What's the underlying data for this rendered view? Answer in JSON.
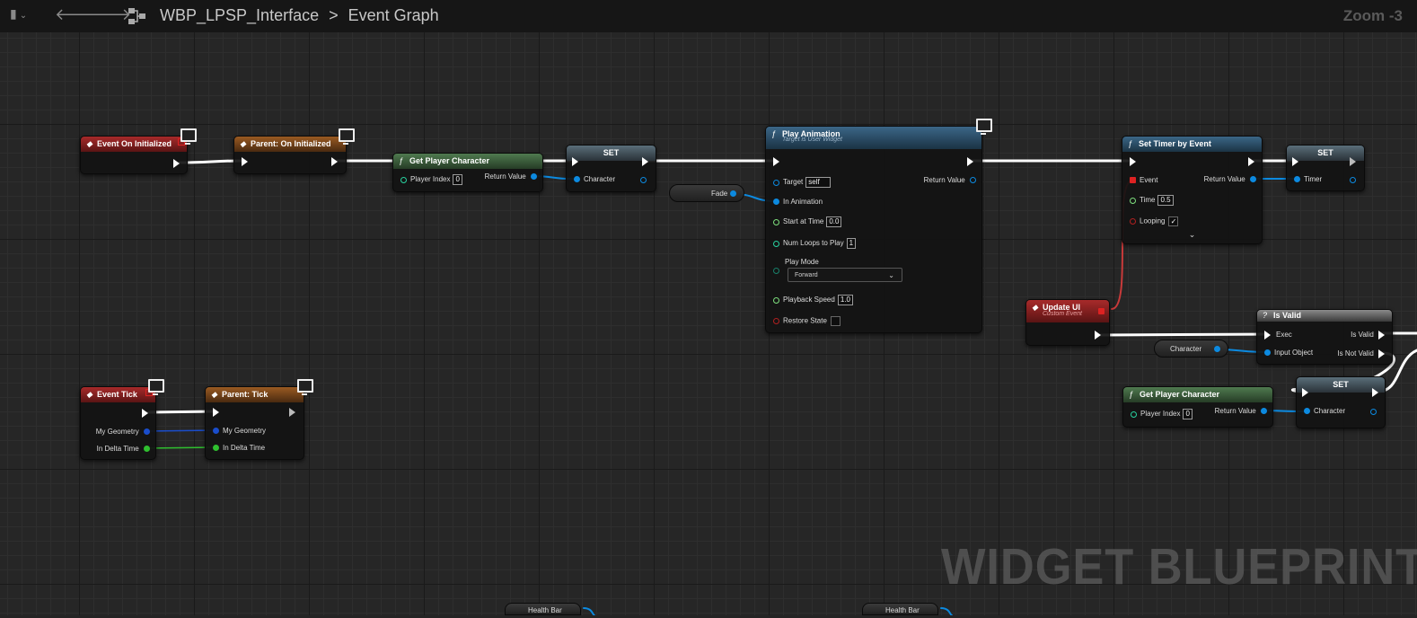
{
  "toolbar": {
    "breadcrumb_asset": "WBP_LPSP_Interface",
    "breadcrumb_separator": ">",
    "breadcrumb_graph": "Event Graph",
    "zoom": "Zoom -3"
  },
  "watermark": "WIDGET BLUEPRINT",
  "nodes": {
    "event_on_initialized": {
      "title": "Event On Initialized"
    },
    "parent_on_initialized": {
      "title": "Parent: On Initialized"
    },
    "get_player_character_1": {
      "title": "Get Player Character",
      "player_index_label": "Player Index",
      "player_index_value": "0",
      "return_label": "Return Value"
    },
    "set_1": {
      "title": "SET",
      "character_label": "Character"
    },
    "play_animation": {
      "title": "Play Animation",
      "subtitle": "Target is User Widget",
      "target_label": "Target",
      "target_value": "self",
      "in_animation_label": "In Animation",
      "start_at_time_label": "Start at Time",
      "start_at_time_value": "0.0",
      "num_loops_label": "Num Loops to Play",
      "num_loops_value": "1",
      "play_mode_label": "Play Mode",
      "play_mode_value": "Forward",
      "playback_speed_label": "Playback Speed",
      "playback_speed_value": "1.0",
      "restore_state_label": "Restore State",
      "return_label": "Return Value"
    },
    "fade_var": {
      "label": "Fade"
    },
    "set_timer_by_event": {
      "title": "Set Timer by Event",
      "event_label": "Event",
      "return_label": "Return Value",
      "time_label": "Time",
      "time_value": "0.5",
      "looping_label": "Looping",
      "looping_check": "✓",
      "expand": "⌄"
    },
    "set_2": {
      "title": "SET",
      "timer_label": "Timer"
    },
    "update_ui": {
      "title": "Update UI",
      "subtitle": "Custom Event"
    },
    "is_valid": {
      "title": "Is Valid",
      "exec_label": "Exec",
      "input_label": "Input Object",
      "is_valid_label": "Is Valid",
      "is_not_valid_label": "Is Not Valid"
    },
    "character_var": {
      "label": "Character"
    },
    "get_player_character_2": {
      "title": "Get Player Character",
      "player_index_label": "Player Index",
      "player_index_value": "0",
      "return_label": "Return Value"
    },
    "set_3": {
      "title": "SET",
      "character_label": "Character"
    },
    "event_tick": {
      "title": "Event Tick",
      "geometry_label": "My Geometry",
      "delta_label": "In Delta Time"
    },
    "parent_tick": {
      "title": "Parent: Tick",
      "geometry_label": "My Geometry",
      "delta_label": "In Delta Time"
    },
    "health_bar_1": {
      "label": "Health Bar"
    },
    "health_bar_2": {
      "label": "Health Bar"
    }
  },
  "icons": {
    "function": "ƒ",
    "event": "◆",
    "is_valid": "?",
    "back": "🡐",
    "forward": "🡒",
    "bookmark": "▮"
  },
  "colors": {
    "event_header": "#a82a2a",
    "parent_header": "#9a5a22",
    "pure_function_header": "#4f7a4f",
    "function_header": "#3b6687",
    "object_pin": "#0c8ae0",
    "struct_pin": "#2fbf2f",
    "delegate_wire": "#c83a3a",
    "exec_wire": "#ffffff"
  }
}
